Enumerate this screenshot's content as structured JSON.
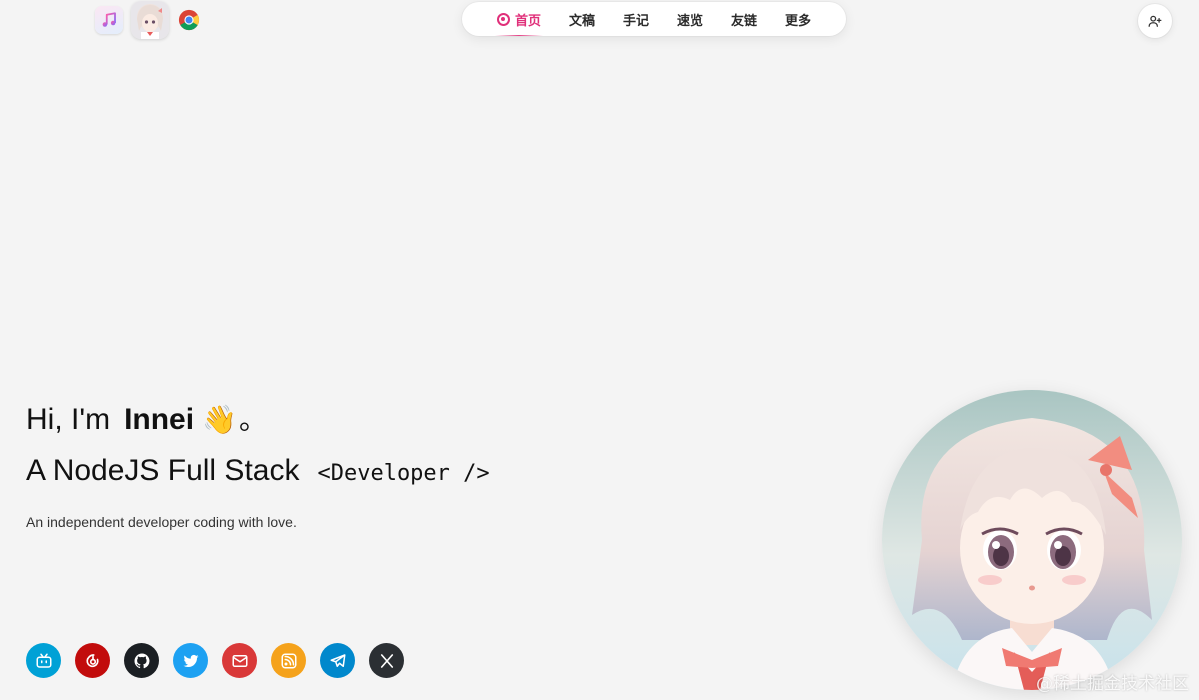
{
  "dock": {
    "apps": [
      {
        "name": "music-app-icon"
      },
      {
        "name": "avatar-app-icon"
      },
      {
        "name": "chrome-app-icon"
      }
    ]
  },
  "nav": {
    "items": [
      {
        "label": "首页",
        "active": true,
        "icon": "target-icon"
      },
      {
        "label": "文稿"
      },
      {
        "label": "手记"
      },
      {
        "label": "速览"
      },
      {
        "label": "友链"
      },
      {
        "label": "更多"
      }
    ],
    "accent_color": "#e0307a"
  },
  "user_button": {
    "icon": "user-plus-icon"
  },
  "hero": {
    "greeting": "Hi, I'm",
    "name": "Innei",
    "wave": "👋",
    "period": "。",
    "role": "A NodeJS Full Stack",
    "code_tag": "<Developer />",
    "description": "An independent developer coding with love."
  },
  "socials": [
    {
      "name": "bilibili-icon",
      "color": "#00a1d6"
    },
    {
      "name": "netease-music-icon",
      "color": "#c20c0c"
    },
    {
      "name": "github-icon",
      "color": "#1b1f23"
    },
    {
      "name": "twitter-icon",
      "color": "#1da1f2"
    },
    {
      "name": "email-icon",
      "color": "#d93838"
    },
    {
      "name": "rss-icon",
      "color": "#f5a21b"
    },
    {
      "name": "telegram-icon",
      "color": "#0088cc"
    },
    {
      "name": "x-icon",
      "color": "#2b2f33"
    }
  ],
  "watermark": "@稀土掘金技术社区"
}
